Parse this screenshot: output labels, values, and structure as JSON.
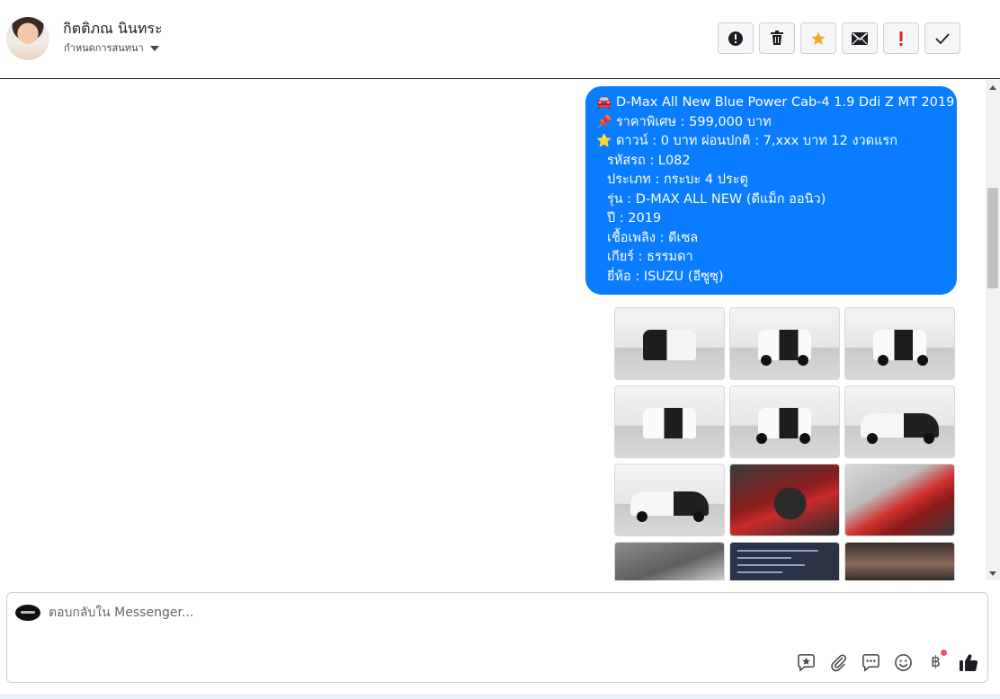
{
  "header": {
    "contact_name": "กิตติภณ นินทระ",
    "assign_label": "กำหนดการสนทนา",
    "actions": [
      {
        "name": "spam-alert",
        "icon": "alert-circle-icon"
      },
      {
        "name": "delete",
        "icon": "trash-icon"
      },
      {
        "name": "star",
        "icon": "star-icon",
        "color": "#f5a623"
      },
      {
        "name": "mark-unread",
        "icon": "envelope-icon"
      },
      {
        "name": "follow-up",
        "icon": "exclamation-icon",
        "color": "#e02020"
      },
      {
        "name": "mark-done",
        "icon": "check-icon"
      }
    ]
  },
  "message": {
    "bubble_color": "#0a7cff",
    "lines": [
      {
        "icon": "🚘",
        "text": "D-Max All New Blue Power Cab-4 1.9 Ddi Z MT 2019"
      },
      {
        "icon": "📌",
        "text": "ราคาพิเศษ : 599,000 บาท"
      },
      {
        "icon": "⭐",
        "text": "ดาวน์ : 0 บาท ผ่อนปกติ : 7,xxx บาท 12 งวดแรก"
      },
      {
        "icon": "",
        "text": "รหัสรถ : L082"
      },
      {
        "icon": "",
        "text": "ประเภท : กระบะ 4 ประตู"
      },
      {
        "icon": "",
        "text": "รุ่น : D-MAX ALL NEW (ดีแม็ก ออนิว)"
      },
      {
        "icon": "",
        "text": "ปี : 2019"
      },
      {
        "icon": "",
        "text": "เชื้อเพลิง : ดีเซล"
      },
      {
        "icon": "",
        "text": "เกียร์ : ธรรมดา"
      },
      {
        "icon": "",
        "text": "ยี่ห้อ : ISUZU (อีซูซุ)"
      }
    ],
    "photos": [
      "car-front-photo",
      "car-front-angle-photo",
      "car-rear-angle-photo",
      "car-rear-photo",
      "car-rear-quarter-photo",
      "car-side-open-doors-photo",
      "car-side-photo",
      "steering-wheel-photo",
      "red-seats-photo",
      "wheel-closeup-photo",
      "spec-sheet-photo",
      "gauge-cluster-photo"
    ]
  },
  "composer": {
    "placeholder": "ตอบกลับใน Messenger...",
    "tools": [
      "saved-reply-icon",
      "attachment-icon",
      "quick-reply-icon",
      "emoji-icon",
      "baht-payment-icon",
      "like-icon"
    ],
    "baht_symbol": "฿"
  }
}
